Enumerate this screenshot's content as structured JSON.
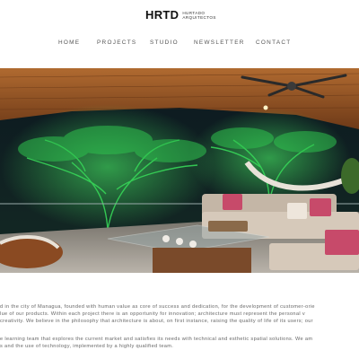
{
  "brand": {
    "mark": "HRTD",
    "name_line1": "HURTADO",
    "name_line2": "ARQUITECTOS"
  },
  "nav": {
    "items": [
      {
        "label": "HOME"
      },
      {
        "label": "PROJECTS"
      },
      {
        "label": "STUDIO"
      },
      {
        "label": "NEWSLETTER"
      },
      {
        "label": "CONTACT"
      }
    ]
  },
  "hero": {
    "icon": "terrace-photo",
    "colors": {
      "wood": "#9a5a2a",
      "tree_glow": "#3cdc5c",
      "night": "#0e1a22"
    }
  },
  "about": {
    "paragraph1": [
      "d in the city of Managua, founded with human value as core of success and dedication, for the development of customer-orie",
      "lue of our products. Within each project there is an opportunity for innovation; architecture must represent the personal v",
      "creativity. We believe in the philosophy that architecture is about, on first instance, raising the quality of life of its users; our"
    ],
    "paragraph2": [
      "e learning team that explores the current market and satisfies its needs with technical and esthetic spatial solutions. We am",
      "s and the use of technology, implemented by a highly qualified team."
    ]
  }
}
